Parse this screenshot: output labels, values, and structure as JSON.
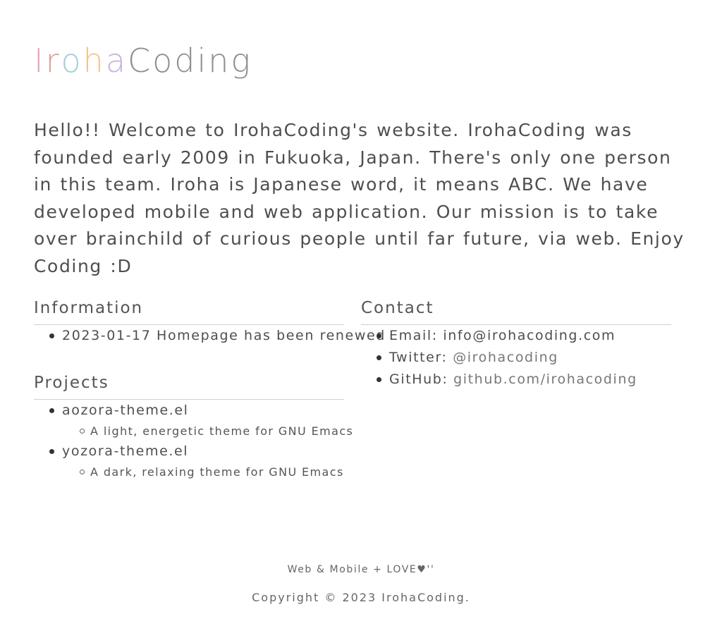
{
  "logo": {
    "letters": [
      {
        "char": "I",
        "color": "#e6a6c4"
      },
      {
        "char": "r",
        "color": "#d9a098"
      },
      {
        "char": "o",
        "color": "#9fd1d8"
      },
      {
        "char": "h",
        "color": "#f2c48a"
      },
      {
        "char": "a",
        "color": "#c9b2e0"
      }
    ],
    "suffix": "Coding",
    "suffix_color": "#8f8f8f"
  },
  "intro": {
    "text": "Hello!! Welcome to IrohaCoding's website. IrohaCoding was founded early 2009 in Fukuoka, Japan. There's only one person in this team. Iroha is Japanese word, it means ABC. We have developed mobile and web application. Our mission is to take over brainchild of curious people until far future, via web. Enjoy Coding :D"
  },
  "information": {
    "heading": "Information",
    "items": [
      {
        "text": "2023-01-17 Homepage has been renewed"
      }
    ]
  },
  "projects": {
    "heading": "Projects",
    "items": [
      {
        "name": "aozora-theme.el",
        "description": "A light, energetic theme for GNU Emacs"
      },
      {
        "name": "yozora-theme.el",
        "description": "A dark, relaxing theme for GNU Emacs"
      }
    ]
  },
  "contact": {
    "heading": "Contact",
    "items": [
      {
        "label": "Email: ",
        "value": "info@irohacoding.com"
      },
      {
        "label": "Twitter: ",
        "value": "@irohacoding"
      },
      {
        "label": "GitHub: ",
        "value": "github.com/irohacoding"
      }
    ]
  },
  "footer": {
    "tagline": "Web & Mobile + LOVE♥''",
    "copyright": "Copyright © 2023 IrohaCoding."
  }
}
